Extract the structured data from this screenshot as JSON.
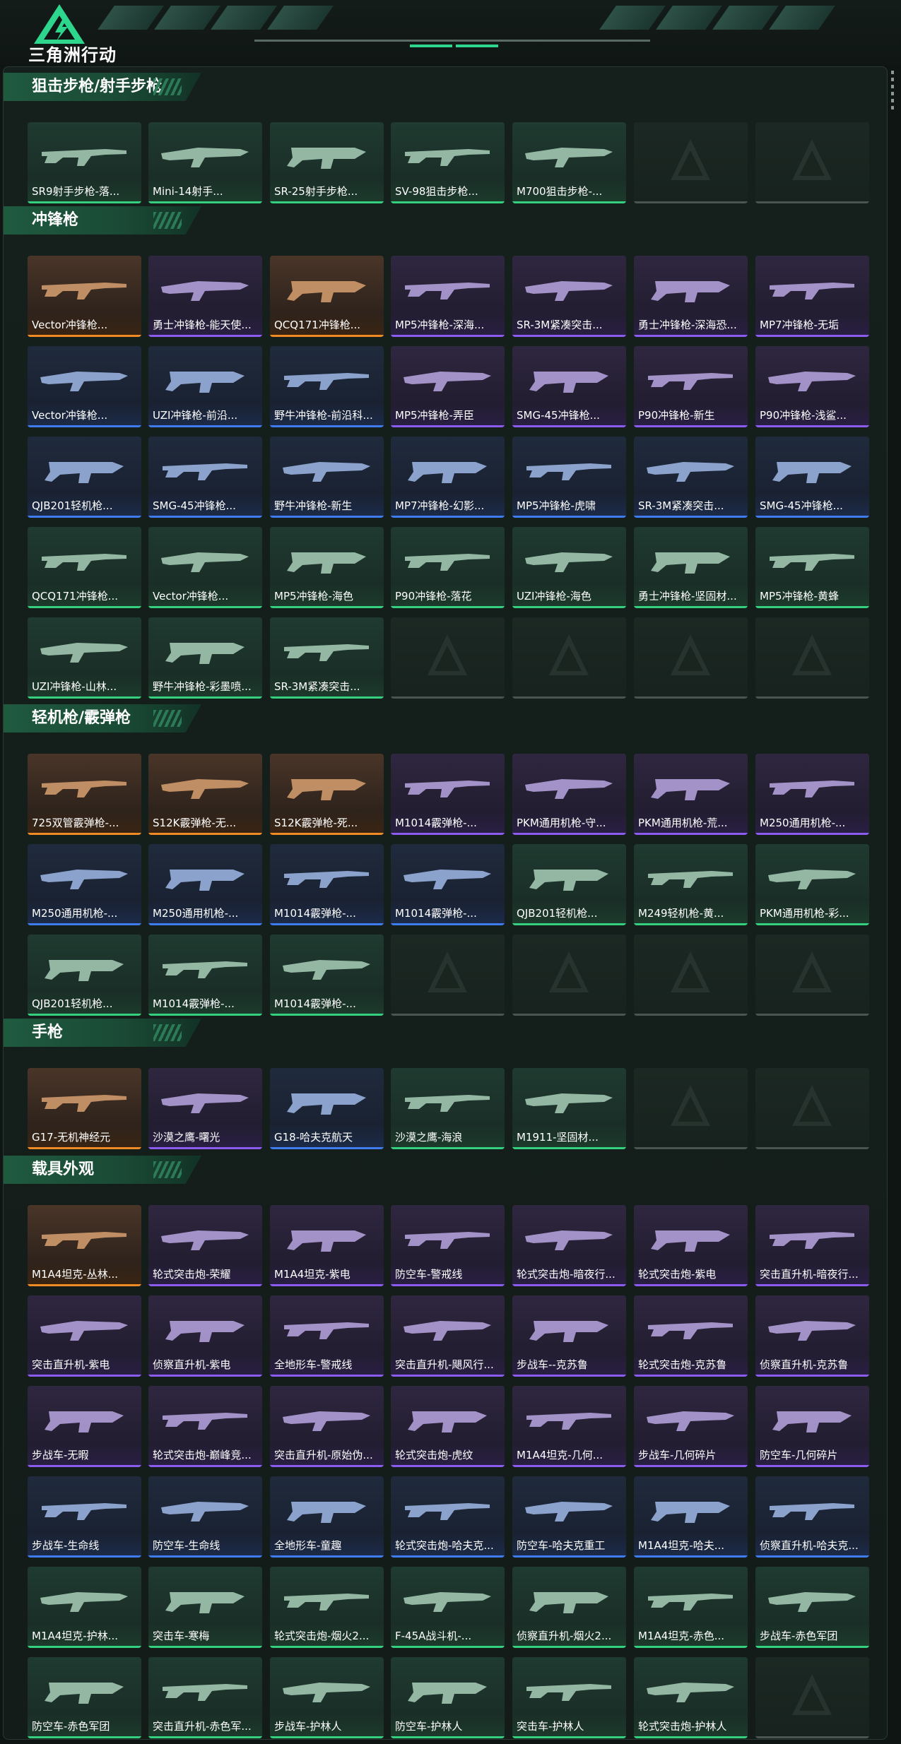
{
  "app": {
    "brand": "三角洲行动"
  },
  "colors": {
    "orange": "#f08a24",
    "purple": "#8c5cf0",
    "blue": "#3f7cf0",
    "green": "#35d07f",
    "accent": "#2ed58d"
  },
  "sections": [
    {
      "title": "狙击步枪/射手步枪",
      "items": [
        {
          "label": "SR9射手步枪-落...",
          "rarity": "green"
        },
        {
          "label": "Mini-14射手...",
          "rarity": "green"
        },
        {
          "label": "SR-25射手步枪...",
          "rarity": "green"
        },
        {
          "label": "SV-98狙击步枪...",
          "rarity": "green"
        },
        {
          "label": "M700狙击步枪-...",
          "rarity": "green"
        },
        {
          "label": "",
          "rarity": "empty"
        },
        {
          "label": "",
          "rarity": "empty"
        }
      ]
    },
    {
      "title": "冲锋枪",
      "items": [
        {
          "label": "Vector冲锋枪...",
          "rarity": "orange"
        },
        {
          "label": "勇士冲锋枪-能天使...",
          "rarity": "purple"
        },
        {
          "label": "QCQ171冲锋枪...",
          "rarity": "orange"
        },
        {
          "label": "MP5冲锋枪-深海...",
          "rarity": "purple"
        },
        {
          "label": "SR-3M紧凑突击...",
          "rarity": "purple"
        },
        {
          "label": "勇士冲锋枪-深海恐...",
          "rarity": "purple"
        },
        {
          "label": "MP7冲锋枪-无垢",
          "rarity": "purple"
        },
        {
          "label": "Vector冲锋枪...",
          "rarity": "blue"
        },
        {
          "label": "UZI冲锋枪-前沿...",
          "rarity": "blue"
        },
        {
          "label": "野牛冲锋枪-前沿科...",
          "rarity": "blue"
        },
        {
          "label": "MP5冲锋枪-弄臣",
          "rarity": "purple"
        },
        {
          "label": "SMG-45冲锋枪...",
          "rarity": "purple"
        },
        {
          "label": "P90冲锋枪-新生",
          "rarity": "purple"
        },
        {
          "label": "P90冲锋枪-浅鲨...",
          "rarity": "purple"
        },
        {
          "label": "QJB201轻机枪...",
          "rarity": "blue"
        },
        {
          "label": "SMG-45冲锋枪...",
          "rarity": "blue"
        },
        {
          "label": "野牛冲锋枪-新生",
          "rarity": "blue"
        },
        {
          "label": "MP7冲锋枪-幻影...",
          "rarity": "blue"
        },
        {
          "label": "MP5冲锋枪-虎啸",
          "rarity": "blue"
        },
        {
          "label": "SR-3M紧凑突击...",
          "rarity": "blue"
        },
        {
          "label": "SMG-45冲锋枪...",
          "rarity": "blue"
        },
        {
          "label": "QCQ171冲锋枪...",
          "rarity": "green"
        },
        {
          "label": "Vector冲锋枪...",
          "rarity": "green"
        },
        {
          "label": "MP5冲锋枪-海色",
          "rarity": "green"
        },
        {
          "label": "P90冲锋枪-落花",
          "rarity": "green"
        },
        {
          "label": "UZI冲锋枪-海色",
          "rarity": "green"
        },
        {
          "label": "勇士冲锋枪-坚固材...",
          "rarity": "green"
        },
        {
          "label": "MP5冲锋枪-黄蜂",
          "rarity": "green"
        },
        {
          "label": "UZI冲锋枪-山林...",
          "rarity": "green"
        },
        {
          "label": "野牛冲锋枪-彩墨喷...",
          "rarity": "green"
        },
        {
          "label": "SR-3M紧凑突击...",
          "rarity": "green"
        },
        {
          "label": "",
          "rarity": "empty"
        },
        {
          "label": "",
          "rarity": "empty"
        },
        {
          "label": "",
          "rarity": "empty"
        },
        {
          "label": "",
          "rarity": "empty"
        }
      ]
    },
    {
      "title": "轻机枪/霰弹枪",
      "items": [
        {
          "label": "725双管霰弹枪-...",
          "rarity": "orange"
        },
        {
          "label": "S12K霰弹枪-无...",
          "rarity": "orange"
        },
        {
          "label": "S12K霰弹枪-死...",
          "rarity": "orange"
        },
        {
          "label": "M1014霰弹枪-...",
          "rarity": "purple"
        },
        {
          "label": "PKM通用机枪-守...",
          "rarity": "purple"
        },
        {
          "label": "PKM通用机枪-荒...",
          "rarity": "purple"
        },
        {
          "label": "M250通用机枪-...",
          "rarity": "purple"
        },
        {
          "label": "M250通用机枪-...",
          "rarity": "blue"
        },
        {
          "label": "M250通用机枪-...",
          "rarity": "blue"
        },
        {
          "label": "M1014霰弹枪-...",
          "rarity": "blue"
        },
        {
          "label": "M1014霰弹枪-...",
          "rarity": "blue"
        },
        {
          "label": "QJB201轻机枪...",
          "rarity": "green"
        },
        {
          "label": "M249轻机枪-黄...",
          "rarity": "green"
        },
        {
          "label": "PKM通用机枪-彩...",
          "rarity": "green"
        },
        {
          "label": "QJB201轻机枪...",
          "rarity": "green"
        },
        {
          "label": "M1014霰弹枪-...",
          "rarity": "green"
        },
        {
          "label": "M1014霰弹枪-...",
          "rarity": "green"
        },
        {
          "label": "",
          "rarity": "empty"
        },
        {
          "label": "",
          "rarity": "empty"
        },
        {
          "label": "",
          "rarity": "empty"
        },
        {
          "label": "",
          "rarity": "empty"
        }
      ]
    },
    {
      "title": "手枪",
      "items": [
        {
          "label": "G17-无机神经元",
          "rarity": "orange"
        },
        {
          "label": "沙漠之鹰-曙光",
          "rarity": "purple"
        },
        {
          "label": "G18-哈夫克航天",
          "rarity": "blue"
        },
        {
          "label": "沙漠之鹰-海浪",
          "rarity": "green"
        },
        {
          "label": "M1911-坚固材...",
          "rarity": "green"
        },
        {
          "label": "",
          "rarity": "empty"
        },
        {
          "label": "",
          "rarity": "empty"
        }
      ]
    },
    {
      "title": "载具外观",
      "items": [
        {
          "label": "M1A4坦克-丛林...",
          "rarity": "orange"
        },
        {
          "label": "轮式突击炮-荣耀",
          "rarity": "purple"
        },
        {
          "label": "M1A4坦克-紫电",
          "rarity": "purple"
        },
        {
          "label": "防空车-警戒线",
          "rarity": "purple"
        },
        {
          "label": "轮式突击炮-暗夜行...",
          "rarity": "purple"
        },
        {
          "label": "轮式突击炮-紫电",
          "rarity": "purple"
        },
        {
          "label": "突击直升机-暗夜行...",
          "rarity": "purple"
        },
        {
          "label": "突击直升机-紫电",
          "rarity": "purple"
        },
        {
          "label": "侦察直升机-紫电",
          "rarity": "purple"
        },
        {
          "label": "全地形车-警戒线",
          "rarity": "purple"
        },
        {
          "label": "突击直升机-飓风行...",
          "rarity": "purple"
        },
        {
          "label": "步战车--克苏鲁",
          "rarity": "purple"
        },
        {
          "label": "轮式突击炮-克苏鲁",
          "rarity": "purple"
        },
        {
          "label": "侦察直升机-克苏鲁",
          "rarity": "purple"
        },
        {
          "label": "步战车-无暇",
          "rarity": "purple"
        },
        {
          "label": "轮式突击炮-巅峰竞...",
          "rarity": "purple"
        },
        {
          "label": "突击直升机-原始伪...",
          "rarity": "purple"
        },
        {
          "label": "轮式突击炮-虎纹",
          "rarity": "purple"
        },
        {
          "label": "M1A4坦克-几何...",
          "rarity": "purple"
        },
        {
          "label": "步战车-几何碎片",
          "rarity": "purple"
        },
        {
          "label": "防空车-几何碎片",
          "rarity": "purple"
        },
        {
          "label": "步战车-生命线",
          "rarity": "blue"
        },
        {
          "label": "防空车-生命线",
          "rarity": "blue"
        },
        {
          "label": "全地形车-童趣",
          "rarity": "blue"
        },
        {
          "label": "轮式突击炮-哈夫克...",
          "rarity": "blue"
        },
        {
          "label": "防空车-哈夫克重工",
          "rarity": "blue"
        },
        {
          "label": "M1A4坦克-哈夫...",
          "rarity": "blue"
        },
        {
          "label": "侦察直升机-哈夫克...",
          "rarity": "blue"
        },
        {
          "label": "M1A4坦克-护林...",
          "rarity": "green"
        },
        {
          "label": "突击车-寒梅",
          "rarity": "green"
        },
        {
          "label": "轮式突击炮-烟火2...",
          "rarity": "green"
        },
        {
          "label": "F-45A战斗机-...",
          "rarity": "green"
        },
        {
          "label": "侦察直升机-烟火2...",
          "rarity": "green"
        },
        {
          "label": "M1A4坦克-赤色...",
          "rarity": "green"
        },
        {
          "label": "步战车-赤色军团",
          "rarity": "green"
        },
        {
          "label": "防空车-赤色军团",
          "rarity": "green"
        },
        {
          "label": "突击直升机-赤色军...",
          "rarity": "green"
        },
        {
          "label": "步战车-护林人",
          "rarity": "green"
        },
        {
          "label": "防空车-护林人",
          "rarity": "green"
        },
        {
          "label": "突击车-护林人",
          "rarity": "green"
        },
        {
          "label": "轮式突击炮-护林人",
          "rarity": "green"
        },
        {
          "label": "",
          "rarity": "empty"
        }
      ]
    }
  ]
}
